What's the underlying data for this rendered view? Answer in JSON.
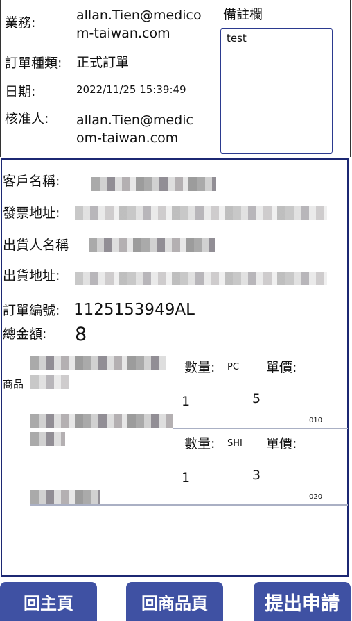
{
  "header": {
    "salesperson_label": "業務:",
    "salesperson_line1": "allan.Tien@medico",
    "salesperson_line2": "m-taiwan.com",
    "order_type_label": "訂單種類:",
    "order_type_value": "正式訂單",
    "date_label": "日期:",
    "date_value": "2022/11/25 15:39:49",
    "approver_label": "核准人:",
    "approver_line1": "allan.Tien@medic",
    "approver_line2": "om-taiwan.com",
    "remark_label": "備註欄",
    "remark_value": "test"
  },
  "details": {
    "customer_label": "客戶名稱:",
    "invoice_address_label": "發票地址:",
    "shipper_label": "出貨人名稱",
    "shipping_address_label": "出貨地址:",
    "order_no_label": "訂單編號:",
    "order_no_value": "1125153949AL",
    "total_label": "總金額:",
    "total_value": "8",
    "product_label": "商品"
  },
  "items": [
    {
      "qty_label": "數量:",
      "unit": "PC",
      "price_label": "單價:",
      "qty": "1",
      "price": "5",
      "code": "010"
    },
    {
      "qty_label": "數量:",
      "unit": "SHI",
      "price_label": "單價:",
      "qty": "1",
      "price": "3",
      "code": "020"
    }
  ],
  "buttons": {
    "home": "回主頁",
    "products": "回商品頁",
    "submit": "提出申請"
  },
  "colors": {
    "button_bg": "#3f51a3",
    "panel_border": "#1c2873"
  }
}
